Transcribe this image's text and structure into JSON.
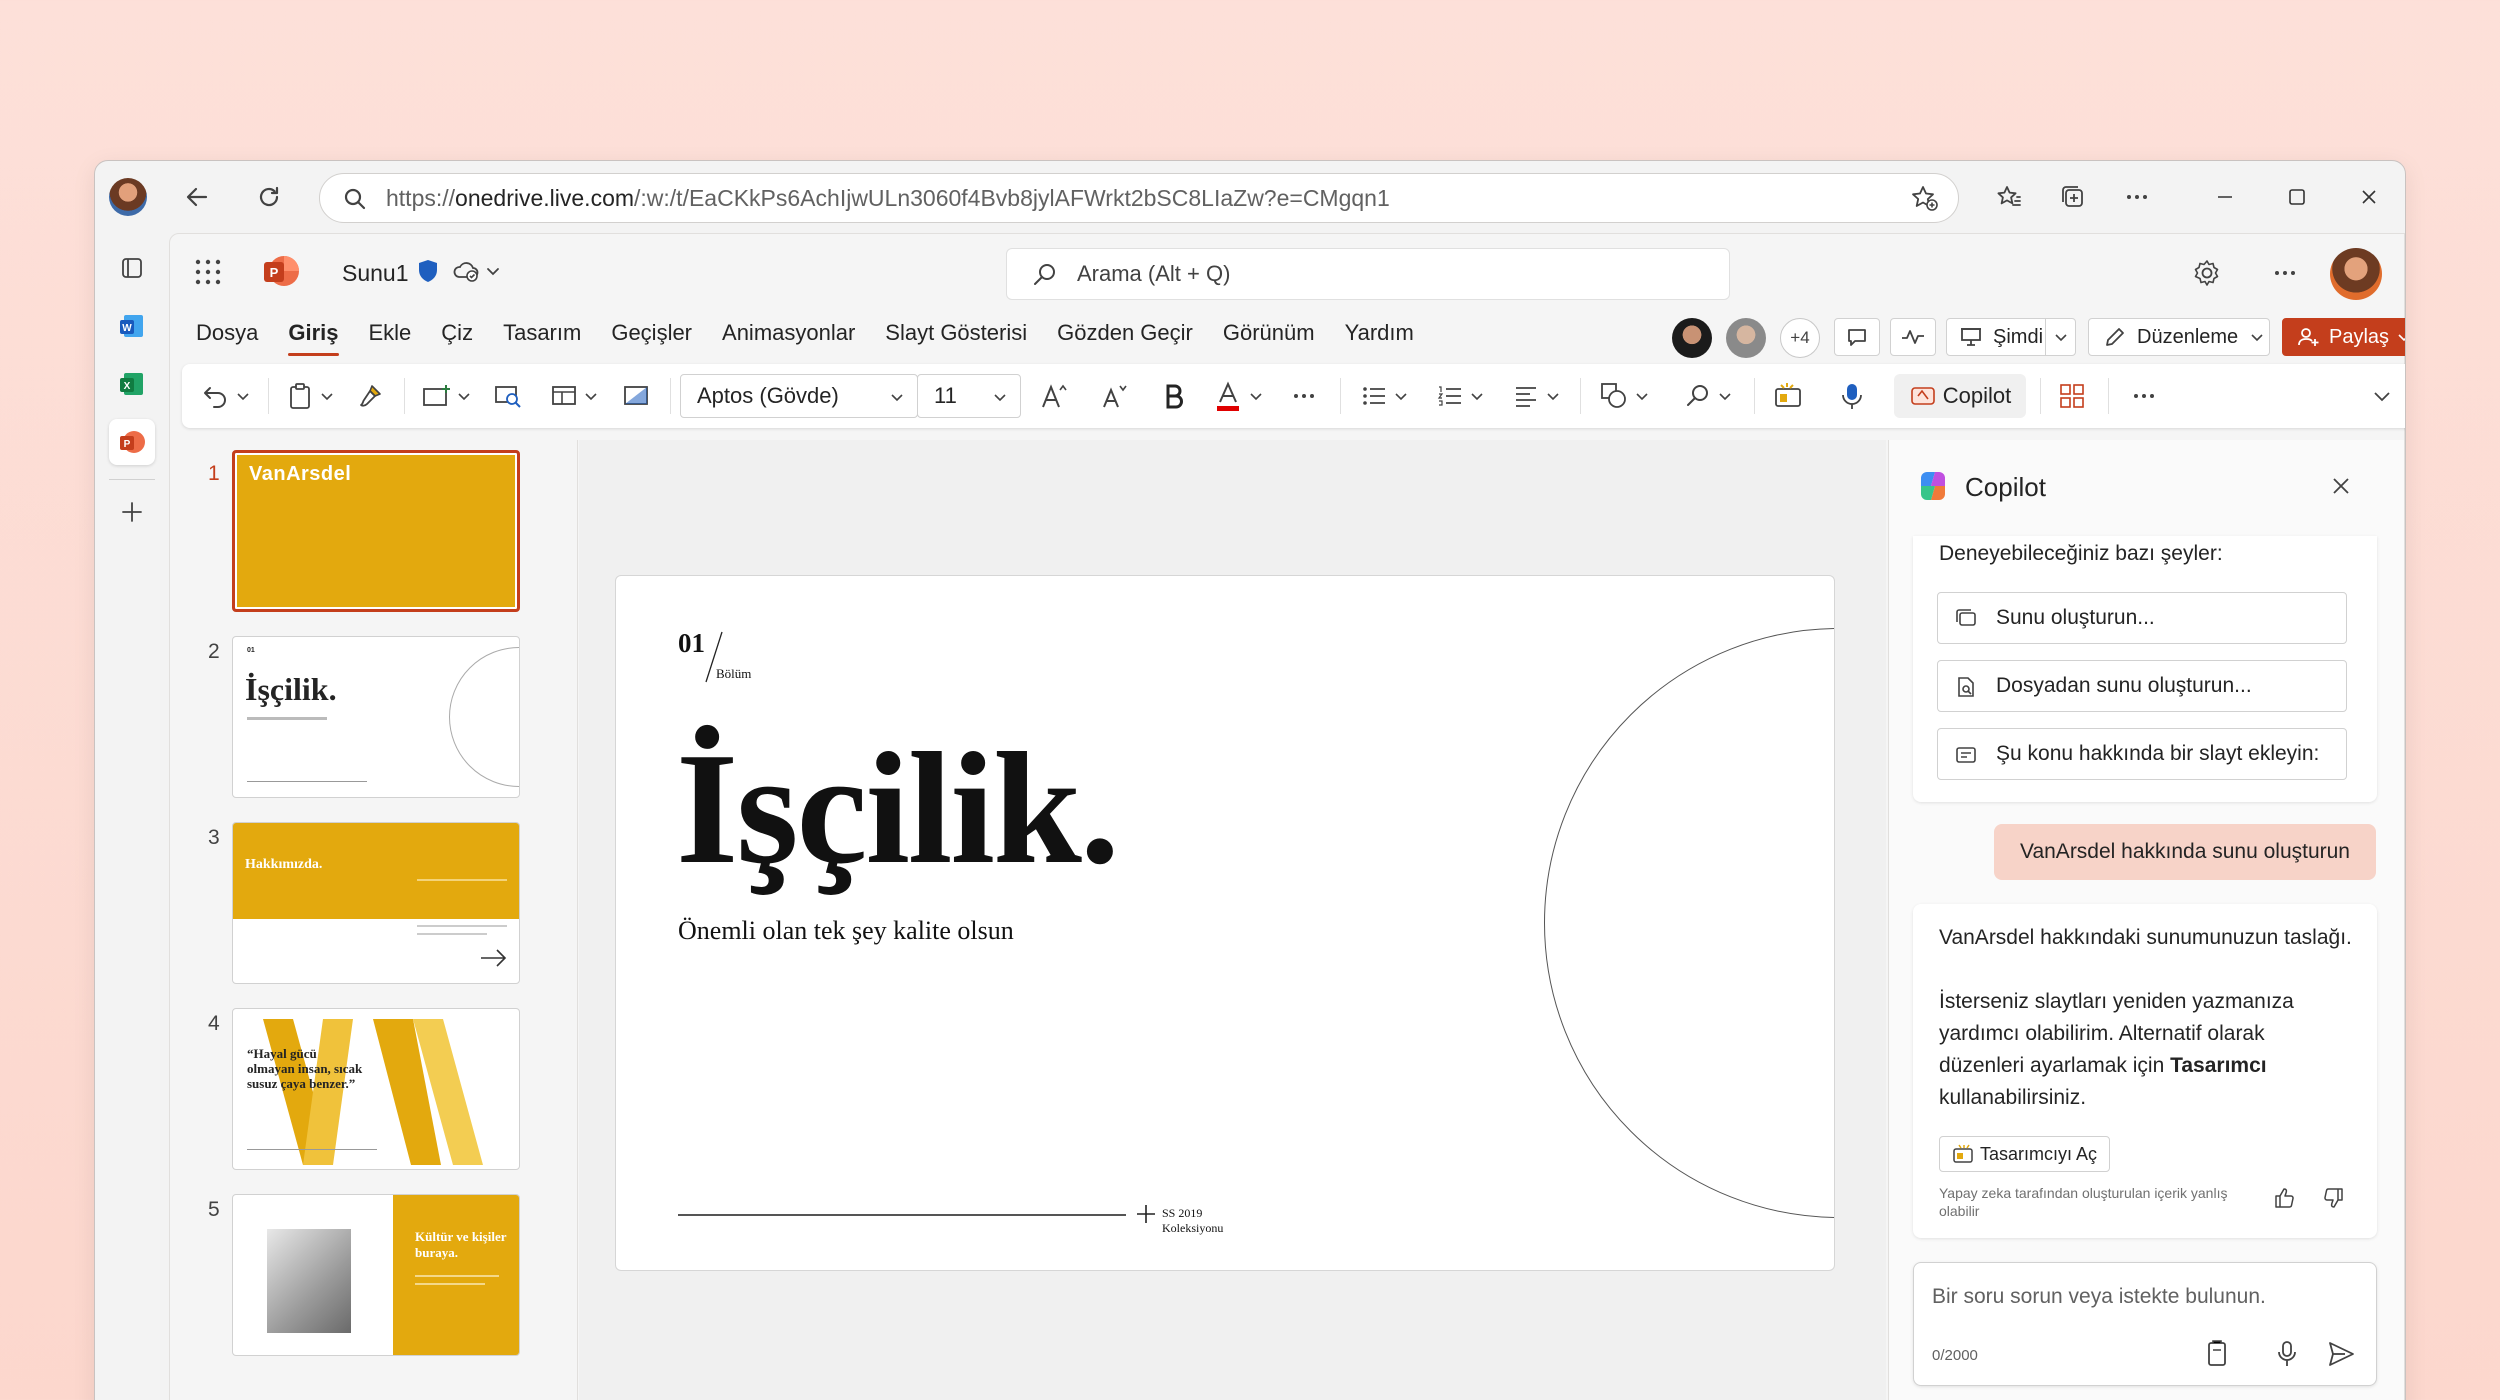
{
  "browser": {
    "url_prefix": "https://",
    "url_domain": "onedrive.live.com",
    "url_rest": "/:w:/t/EaCKkPs6AchIjwULn3060f4Bvb8jylAFWrkt2bSC8LIaZw?e=CMgqn1"
  },
  "app": {
    "doc_name": "Sunu1",
    "search_placeholder": "Arama (Alt + Q)",
    "menu": [
      "Dosya",
      "Giriş",
      "Ekle",
      "Çiz",
      "Tasarım",
      "Geçişler",
      "Animasyonlar",
      "Slayt Gösterisi",
      "Gözden Geçir",
      "Görünüm",
      "Yardım"
    ],
    "active_menu": "Giriş",
    "collab_extra": "+4",
    "present_label": "Şimdi",
    "editing_label": "Düzenleme",
    "share_label": "Paylaş",
    "accent": "#c43e1c"
  },
  "ribbon": {
    "font_name": "Aptos (Gövde)",
    "font_size": "11",
    "copilot_label": "Copilot"
  },
  "thumbs": {
    "numbers": [
      "1",
      "2",
      "3",
      "4",
      "5"
    ],
    "t1_logo": "VanArsdel",
    "t2_title": "İşçilik.",
    "t3_title": "Hakkımızda.",
    "t4_quote": "“Hayal gücü olmayan insan, sıcak susuz çaya benzer.”",
    "t5_title": "Kültür ve kişiler buraya."
  },
  "slide": {
    "section_num": "01",
    "section_label": "Bölüm",
    "title": "İşçilik.",
    "subtitle": "Önemli olan tek şey kalite olsun",
    "footer_line1": "SS 2019",
    "footer_line2": "Koleksiyonu",
    "accent": "#e3a90e"
  },
  "copilot": {
    "title": "Copilot",
    "intro": "Deneyebileceğiniz bazı şeyler:",
    "suggestions": [
      "Sunu oluşturun...",
      "Dosyadan sunu oluşturun...",
      "Şu konu hakkında bir slayt ekleyin:"
    ],
    "user_msg": "VanArsdel hakkında sunu oluşturun",
    "reply_line1": "VanArsdel hakkındaki sunumunuzun taslağı.",
    "reply_p2a": "İsterseniz slaytları yeniden yazmanıza yardımcı olabilirim. Alternatif olarak düzenleri ayarlamak için ",
    "reply_bold": "Tasarımcı",
    "reply_p2b": " kullanabilirsiniz.",
    "designer_btn": "Tasarımcıyı Aç",
    "disclaimer": "Yapay zeka tarafından oluşturulan içerik yanlış olabilir",
    "input_placeholder": "Bir soru sorun veya istekte bulunun.",
    "char_count": "0/2000"
  }
}
